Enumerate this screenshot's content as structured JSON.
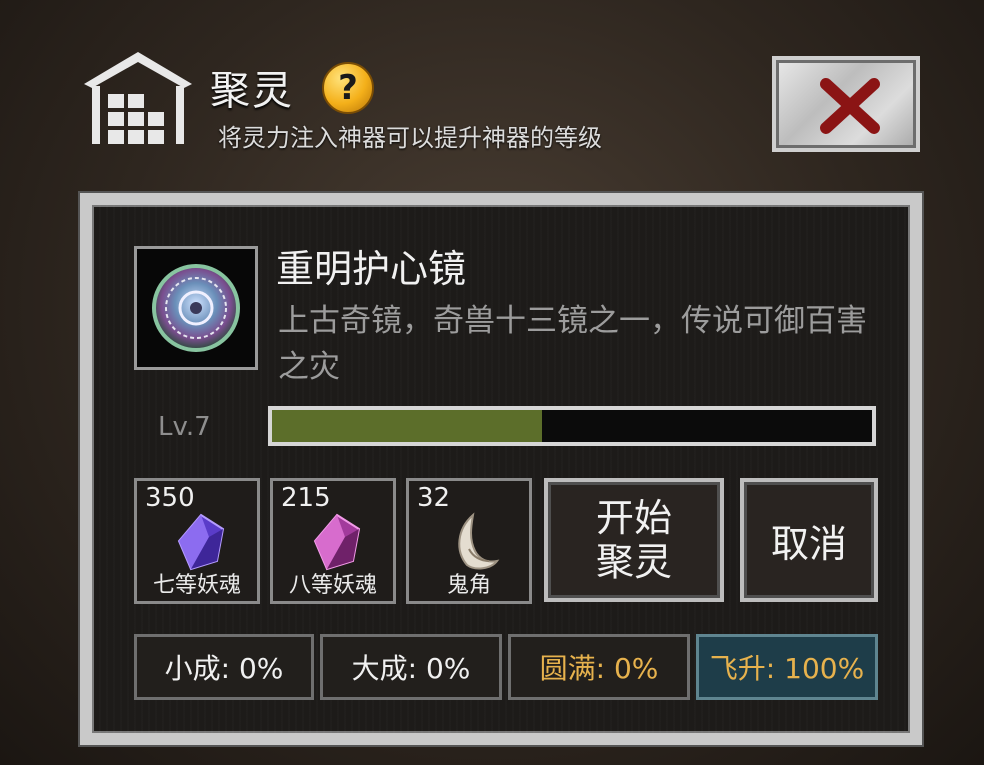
{
  "header": {
    "title": "聚灵",
    "help_icon": "question-mark-icon",
    "help_glyph": "?",
    "subtitle": "将灵力注入神器可以提升神器的等级",
    "close_icon": "close-x-icon"
  },
  "item": {
    "icon": "mirror-icon",
    "name": "重明护心镜",
    "description": "上古奇镜，奇兽十三镜之一，传说可御百害之灾",
    "level": "Lv.7",
    "progress": 0.45
  },
  "materials": [
    {
      "count": "350",
      "label": "七等妖魂",
      "icon": "purple-crystal-icon"
    },
    {
      "count": "215",
      "label": "八等妖魂",
      "icon": "pink-crystal-icon"
    },
    {
      "count": "32",
      "label": "鬼角",
      "icon": "horn-icon"
    }
  ],
  "buttons": {
    "start_label": "开始聚灵",
    "cancel_label": "取消"
  },
  "stages": [
    {
      "label": "小成: 0%"
    },
    {
      "label": "大成: 0%"
    },
    {
      "label": "圆满: 0%"
    },
    {
      "label": "飞升: 100%"
    }
  ],
  "colors": {
    "progress_fill": "#5c6e2a",
    "stage_gold": "#e7b24d",
    "stage_highlight_bg": "#1e3d49"
  }
}
